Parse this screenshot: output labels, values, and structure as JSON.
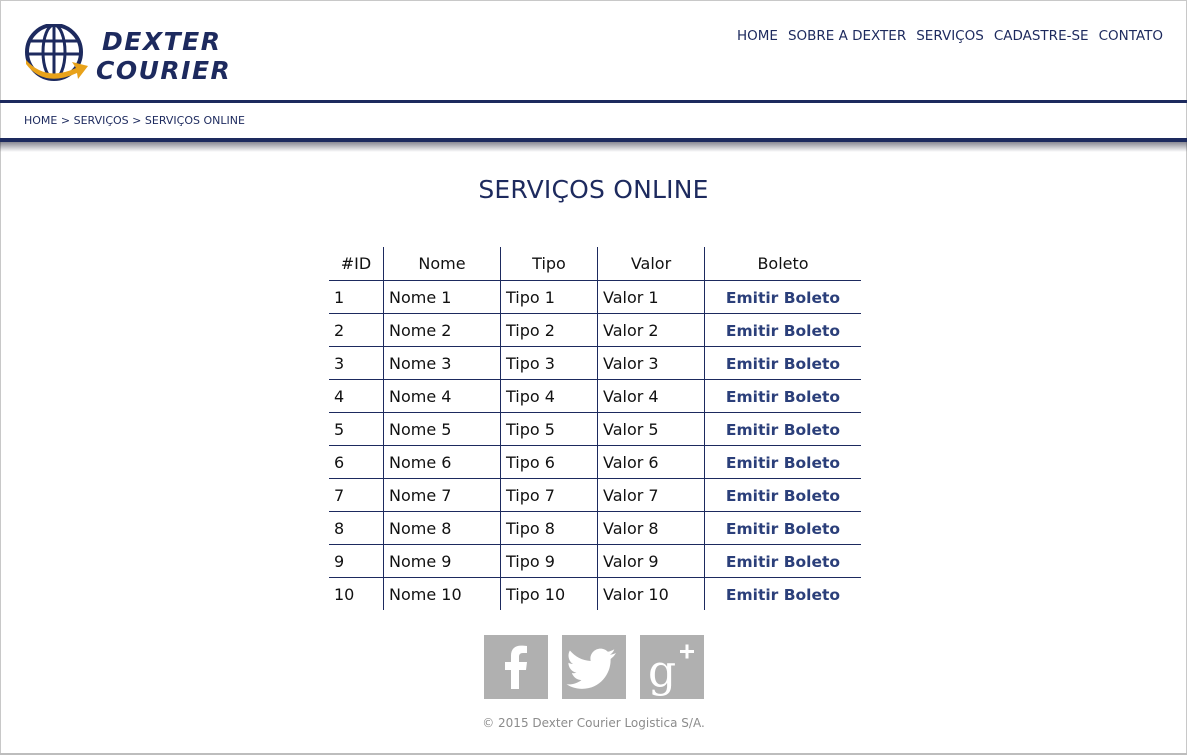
{
  "brand": {
    "line1": "DEXTER",
    "line2": "COURIER",
    "colors": {
      "navy": "#1d2a5e",
      "gold": "#e8a21a"
    }
  },
  "nav": {
    "items": [
      {
        "label": "HOME"
      },
      {
        "label": "SOBRE A DEXTER"
      },
      {
        "label": "SERVIÇOS"
      },
      {
        "label": "CADASTRE-SE"
      },
      {
        "label": "CONTATO"
      }
    ]
  },
  "breadcrumb": {
    "items": [
      {
        "label": "HOME"
      },
      {
        "label": "SERVIÇOS"
      },
      {
        "label": "SERVIÇOS ONLINE"
      }
    ],
    "separator": ">"
  },
  "page": {
    "title": "SERVIÇOS ONLINE"
  },
  "table": {
    "headers": {
      "id": "#ID",
      "nome": "Nome",
      "tipo": "Tipo",
      "valor": "Valor",
      "boleto": "Boleto"
    },
    "rows": [
      {
        "id": "1",
        "nome": "Nome 1",
        "tipo": "Tipo 1",
        "valor": "Valor 1",
        "boleto": "Emitir Boleto"
      },
      {
        "id": "2",
        "nome": "Nome 2",
        "tipo": "Tipo 2",
        "valor": "Valor 2",
        "boleto": "Emitir Boleto"
      },
      {
        "id": "3",
        "nome": "Nome 3",
        "tipo": "Tipo 3",
        "valor": "Valor 3",
        "boleto": "Emitir Boleto"
      },
      {
        "id": "4",
        "nome": "Nome 4",
        "tipo": "Tipo 4",
        "valor": "Valor 4",
        "boleto": "Emitir Boleto"
      },
      {
        "id": "5",
        "nome": "Nome 5",
        "tipo": "Tipo 5",
        "valor": "Valor 5",
        "boleto": "Emitir Boleto"
      },
      {
        "id": "6",
        "nome": "Nome 6",
        "tipo": "Tipo 6",
        "valor": "Valor 6",
        "boleto": "Emitir Boleto"
      },
      {
        "id": "7",
        "nome": "Nome 7",
        "tipo": "Tipo 7",
        "valor": "Valor 7",
        "boleto": "Emitir Boleto"
      },
      {
        "id": "8",
        "nome": "Nome 8",
        "tipo": "Tipo 8",
        "valor": "Valor 8",
        "boleto": "Emitir Boleto"
      },
      {
        "id": "9",
        "nome": "Nome 9",
        "tipo": "Tipo 9",
        "valor": "Valor 9",
        "boleto": "Emitir Boleto"
      },
      {
        "id": "10",
        "nome": "Nome 10",
        "tipo": "Tipo 10",
        "valor": "Valor 10",
        "boleto": "Emitir Boleto"
      }
    ]
  },
  "social": {
    "icons": [
      "facebook-icon",
      "twitter-icon",
      "google-plus-icon"
    ],
    "color": "#b0b0b0"
  },
  "footer": {
    "copyright": "© 2015 Dexter Courier Logistica S/A."
  }
}
